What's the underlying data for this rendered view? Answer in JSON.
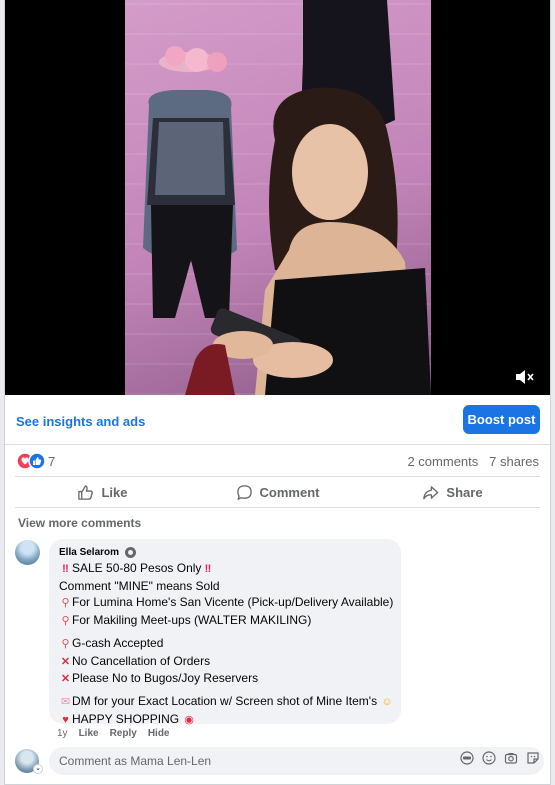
{
  "post": {
    "insights_link": "See insights and ads",
    "boost_button": "Boost post",
    "reaction_count": "7",
    "comments_count": "2 comments",
    "shares_count": "7 shares",
    "actions": {
      "like": "Like",
      "comment": "Comment",
      "share": "Share"
    }
  },
  "comments": {
    "view_more": "View more comments",
    "items": [
      {
        "author": "Ella Selarom",
        "lines": [
          "SALE 50-80 Pesos Only",
          "Comment \"MINE\" means Sold",
          "For Lumina Home's San Vicente (Pick-up/Delivery Available)",
          "For Makiling Meet-ups (WALTER MAKILING)",
          "G-cash Accepted",
          "No Cancellation of Orders",
          "Please No to Bugos/Joy Reservers",
          "DM for your Exact Location w/ Screen shot of Mine Item's",
          "HAPPY SHOPPING"
        ],
        "time": "1y",
        "like": "Like",
        "reply": "Reply",
        "hide": "Hide"
      }
    ]
  },
  "composer": {
    "placeholder": "Comment as Mama Len-Len"
  },
  "colors": {
    "accent": "#1b74e4",
    "muted": "#65676b",
    "bubble": "#f0f2f5"
  },
  "icons": [
    "volume-muted-icon",
    "love-reaction-icon",
    "like-reaction-icon",
    "thumbs-up-icon",
    "comment-icon",
    "share-icon",
    "avatar-icon",
    "gif-icon",
    "emoji-icon",
    "camera-icon",
    "sticker-icon"
  ]
}
